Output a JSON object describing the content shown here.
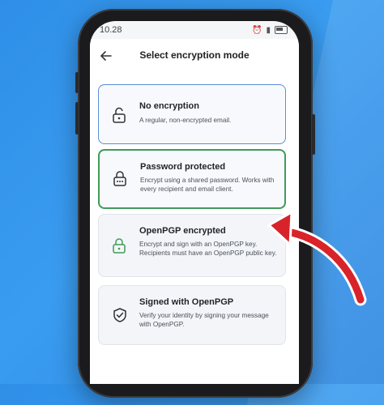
{
  "status": {
    "time": "10.28"
  },
  "appbar": {
    "title": "Select encryption mode",
    "back_icon": "back-arrow-icon"
  },
  "options": [
    {
      "title": "No encryption",
      "description": "A regular, non-encrypted email.",
      "icon": "unlock-icon",
      "state": "default"
    },
    {
      "title": "Password protected",
      "description": "Encrypt using a shared password. Works with every recipient and email client.",
      "icon": "password-lock-icon",
      "state": "highlighted"
    },
    {
      "title": "OpenPGP encrypted",
      "description": "Encrypt and sign with an OpenPGP key. Recipients must have an OpenPGP public key.",
      "icon": "lock-icon",
      "state": "default"
    },
    {
      "title": "Signed with OpenPGP",
      "description": "Verify your identity by signing your message with OpenPGP.",
      "icon": "shield-check-icon",
      "state": "default"
    }
  ],
  "colors": {
    "highlight_green": "#3f9b58",
    "accent_blue": "#5b8fd6",
    "arrow_red": "#d8232a",
    "background": "#2f8fe8"
  }
}
